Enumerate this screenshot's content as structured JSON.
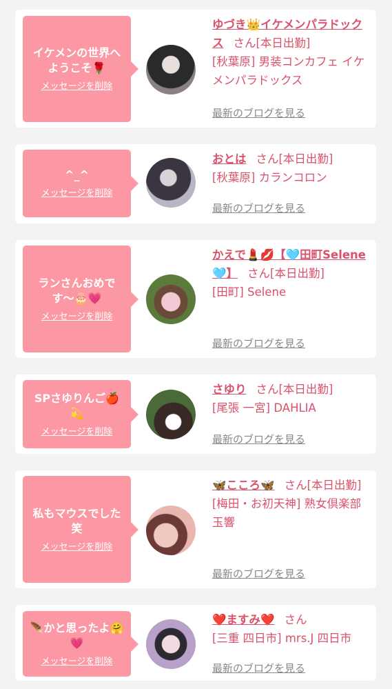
{
  "messages": [
    {
      "bubble": "イケメンの世界へようこそ🌹",
      "delete_label": "メッセージを削除",
      "cast_name": "ゆづき👑イケメンパラドックス",
      "suffix": "さん[本日出勤]",
      "shop": "[秋葉原] 男装コンカフェ イケメンパラドックス",
      "blog_label": "最新のブログを見る",
      "avatar_colors": [
        "#2a2a2a",
        "#e8e0dc"
      ]
    },
    {
      "bubble": "^_^",
      "delete_label": "メッセージを削除",
      "cast_name": "おとは",
      "suffix": "さん[本日出勤]",
      "shop": "[秋葉原] カランコロン",
      "blog_label": "最新のブログを見る",
      "avatar_colors": [
        "#3a3540",
        "#b9b5c4"
      ]
    },
    {
      "bubble": "ランさんおめです〜🎂💗",
      "delete_label": "メッセージを削除",
      "cast_name": "かえで💄💋【🩵田町Selene🩵】",
      "suffix": "さん[本日出勤]",
      "shop": "[田町] Selene",
      "blog_label": "最新のブログを見る",
      "avatar_colors": [
        "#5b7a3c",
        "#f2c9d4"
      ]
    },
    {
      "bubble": "SPさゆりんご🍎💫",
      "delete_label": "メッセージを削除",
      "cast_name": "さゆり",
      "suffix": "さん[本日出勤]",
      "shop": "[尾張 一宮] DAHLIA",
      "blog_label": "最新のブログを見る",
      "avatar_colors": [
        "#4a6a3a",
        "#f0e6e0"
      ]
    },
    {
      "bubble": "私もマウスでした笑",
      "delete_label": "メッセージを削除",
      "cast_name": "🦋こころ🦋",
      "suffix": "さん[本日出勤]",
      "shop": "[梅田・お初天神] 熟女倶楽部 玉響",
      "blog_label": "最新のブログを見る",
      "avatar_colors": [
        "#e9b7b0",
        "#6b3a36"
      ]
    },
    {
      "bubble": "🪶かと思ったよ🤗💗",
      "delete_label": "メッセージを削除",
      "cast_name": "❤️ますみ❤️",
      "suffix": "さん",
      "shop": "[三重 四日市] mrs.J 四日市",
      "blog_label": "最新のブログを見る",
      "avatar_colors": [
        "#b8a0c8",
        "#f3d9e0"
      ]
    }
  ],
  "colors": {
    "accent": "#d9526b",
    "bubble": "#fb98a4",
    "link_gray": "#888888",
    "background": "#f3f3f3"
  }
}
